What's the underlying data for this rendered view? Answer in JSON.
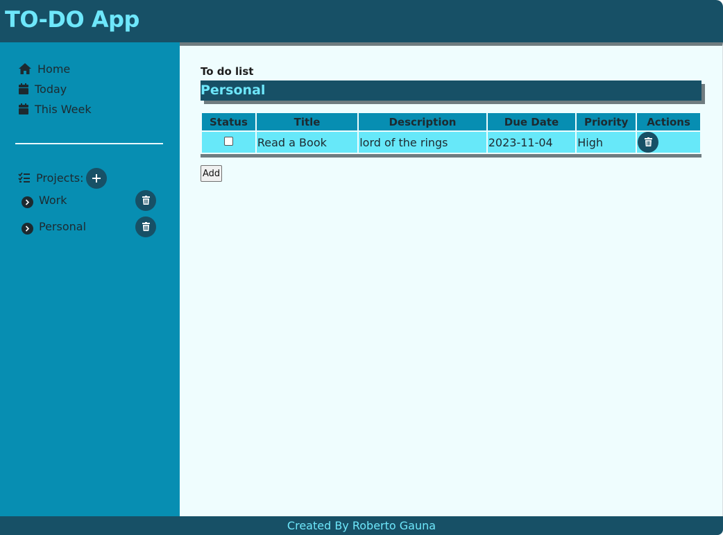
{
  "app": {
    "title": "TO-DO App"
  },
  "sidebar": {
    "nav": [
      {
        "label": "Home",
        "icon": "home-icon"
      },
      {
        "label": "Today",
        "icon": "calendar-icon"
      },
      {
        "label": "This Week",
        "icon": "calendar-icon"
      }
    ],
    "projects_label": "Projects:",
    "projects": [
      {
        "name": "Work"
      },
      {
        "name": "Personal"
      }
    ]
  },
  "main": {
    "list_caption": "To do list",
    "current_project": "Personal",
    "table": {
      "headers": [
        "Status",
        "Title",
        "Description",
        "Due Date",
        "Priority",
        "Actions"
      ],
      "rows": [
        {
          "done": false,
          "title": "Read a Book",
          "description": "lord of the rings",
          "due": "2023-11-04",
          "priority": "High"
        }
      ]
    },
    "add_label": "Add"
  },
  "footer": {
    "text": "Created By Roberto Gauna"
  },
  "colors": {
    "header_bg": "#175066",
    "accent_text": "#6ee7fb",
    "sidebar_bg": "#078eb2",
    "main_bg": "#effdfe",
    "row_bg": "#67e8f9"
  }
}
